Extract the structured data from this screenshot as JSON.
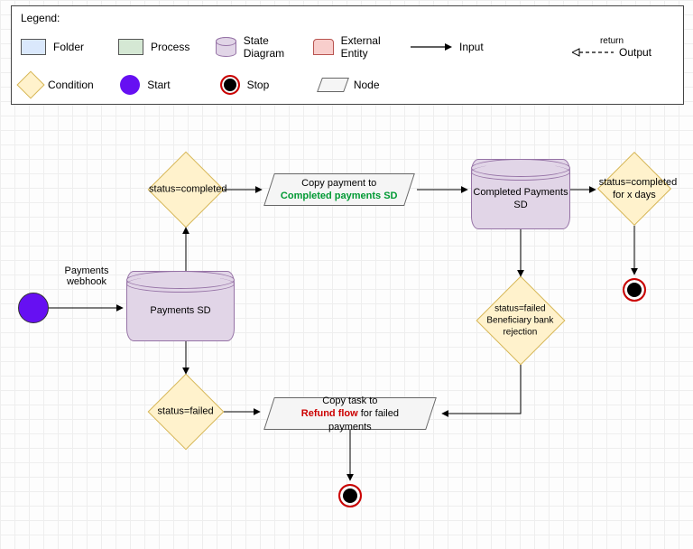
{
  "legend": {
    "title": "Legend:",
    "folder": "Folder",
    "process": "Process",
    "statediagram": "State Diagram",
    "external": "External Entity",
    "input": "Input",
    "output": "Output",
    "return": "return",
    "condition": "Condition",
    "start": "Start",
    "stop": "Stop",
    "node": "Node"
  },
  "nodes": {
    "webhook_label": "Payments webhook",
    "payments_sd": "Payments SD",
    "completed_sd": "Completed Payments SD",
    "cond_completed": "status=completed",
    "cond_failed": "status=failed",
    "cond_completed_days_l1": "status=completed",
    "cond_completed_days_l2": "for x days",
    "cond_bank_l1": "status=failed",
    "cond_bank_l2": "Beneficiary bank",
    "cond_bank_l3": "rejection",
    "copy_payment_l1": "Copy payment to",
    "copy_payment_l2": "Completed payments SD",
    "copy_task_l1": "Copy task to",
    "copy_task_l2a": "Refund flow",
    "copy_task_l2b": " for failed payments"
  }
}
